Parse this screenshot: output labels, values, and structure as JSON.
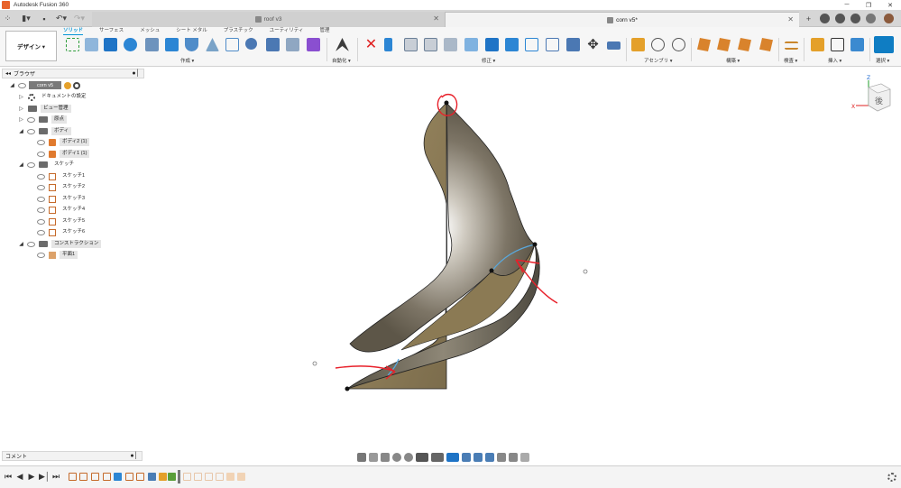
{
  "app": {
    "title": "Autodesk Fusion 360"
  },
  "tabs": [
    {
      "label": "roof v3",
      "active": false
    },
    {
      "label": "corn v5*",
      "active": true
    }
  ],
  "ribbon": {
    "workspace": "デザイン ▾",
    "tabs": [
      "ソリッド",
      "サーフェス",
      "メッシュ",
      "シート メタル",
      "プラスチック",
      "ユーティリティ",
      "管理"
    ],
    "groups": [
      "作成 ▾",
      "自動化 ▾",
      "修正 ▾",
      "アセンブリ ▾",
      "構築 ▾",
      "検査 ▾",
      "挿入 ▾",
      "選択 ▾"
    ]
  },
  "browser": {
    "title": "ブラウザ",
    "root": "corn v5",
    "items": [
      "ドキュメントの設定",
      "ビュー管理",
      "原点",
      "ボディ",
      "ボディ2 (1)",
      "ボディ1 (1)",
      "スケッチ",
      "スケッチ1",
      "スケッチ2",
      "スケッチ3",
      "スケッチ4",
      "スケッチ5",
      "スケッチ6",
      "コンストラクション",
      "平面1"
    ]
  },
  "viewcube": {
    "face": "後",
    "axis_x": "X",
    "axis_z": "Z"
  },
  "comments": {
    "title": "コメント"
  },
  "colors": {
    "accent": "#0696d7",
    "surface": "#8c7a55",
    "annotation": "#e8202a"
  }
}
